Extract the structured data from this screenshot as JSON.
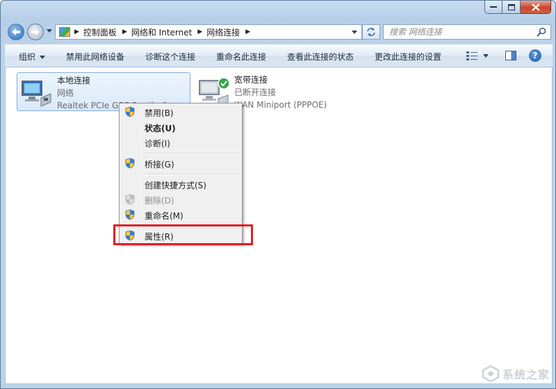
{
  "window": {
    "caption_buttons": [
      "minimize",
      "maximize",
      "close"
    ]
  },
  "address_bar": {
    "breadcrumbs": [
      "控制面板",
      "网络和 Internet",
      "网络连接"
    ]
  },
  "search": {
    "placeholder": "搜索 网络连接"
  },
  "command_bar": {
    "organize": "组织",
    "disable": "禁用此网络设备",
    "diagnose": "诊断这个连接",
    "rename": "重命名此连接",
    "view_status": "查看此连接的状态",
    "change_settings": "更改此连接的设置"
  },
  "connections": [
    {
      "name": "本地连接",
      "status": "网络",
      "device": "Realtek PCIe GBE Family C"
    },
    {
      "name": "宽带连接",
      "status": "已断开连接",
      "device": "WAN Miniport (PPPOE)"
    }
  ],
  "context_menu": {
    "items": [
      {
        "label": "禁用(B)"
      },
      {
        "label": "状态(U)"
      },
      {
        "label": "诊断(I)"
      },
      {
        "label": "桥接(G)"
      },
      {
        "label": "创建快捷方式(S)"
      },
      {
        "label": "删除(D)"
      },
      {
        "label": "重命名(M)"
      },
      {
        "label": "属性(R)"
      }
    ]
  },
  "highlight": {
    "target": "属性(R)",
    "color": "#e01e25"
  },
  "watermark": {
    "text": "系统之家"
  },
  "colors": {
    "selection": "#d9e9fb",
    "menu_bg": "#f0f0f0",
    "accent": "#2c6cb8"
  }
}
